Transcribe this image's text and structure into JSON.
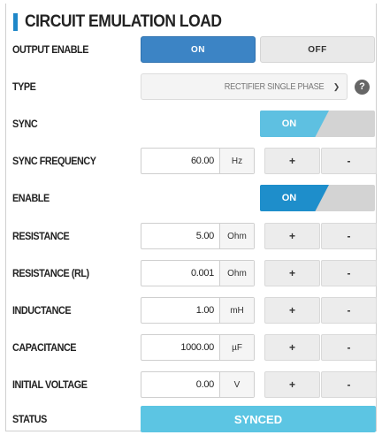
{
  "title": "CIRCUIT EMULATION LOAD",
  "output_enable": {
    "label": "OUTPUT ENABLE",
    "on_label": "ON",
    "off_label": "OFF"
  },
  "type": {
    "label": "TYPE",
    "value": "RECTIFIER SINGLE PHASE",
    "help_icon": "question-circle-icon"
  },
  "sync": {
    "label": "SYNC",
    "toggle_label": "ON",
    "color": "#5ec0e1"
  },
  "sync_frequency": {
    "label": "SYNC FREQUENCY",
    "value": "60.00",
    "unit": "Hz",
    "plus": "+",
    "minus": "-"
  },
  "enable": {
    "label": "ENABLE",
    "toggle_label": "ON",
    "color": "#1e8ecb"
  },
  "resistance": {
    "label": "RESISTANCE",
    "value": "5.00",
    "unit": "Ohm",
    "plus": "+",
    "minus": "-"
  },
  "resistance_rl": {
    "label": "RESISTANCE (RL)",
    "value": "0.001",
    "unit": "Ohm",
    "plus": "+",
    "minus": "-"
  },
  "inductance": {
    "label": "INDUCTANCE",
    "value": "1.00",
    "unit": "mH",
    "plus": "+",
    "minus": "-"
  },
  "capacitance": {
    "label": "CAPACITANCE",
    "value": "1000.00",
    "unit": "µF",
    "plus": "+",
    "minus": "-"
  },
  "initial_voltage": {
    "label": "INITIAL VOLTAGE",
    "value": "0.00",
    "unit": "V",
    "plus": "+",
    "minus": "-"
  },
  "status": {
    "label": "STATUS",
    "value": "SYNCED",
    "color": "#5cc5e3"
  },
  "colors": {
    "accent": "#1e87c8",
    "on_button": "#3c84c5"
  }
}
